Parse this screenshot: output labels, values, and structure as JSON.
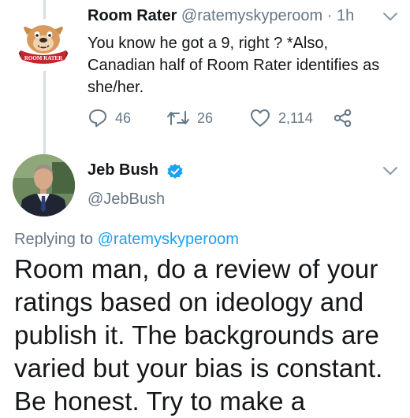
{
  "tweet1": {
    "display_name": "Room Rater",
    "handle": "@ratemyskyperoom",
    "separator": "·",
    "time": "1h",
    "avatar_text": "ROOM RATER",
    "body": "You know he got a 9, right ? *Also, Canadian half of Room Rater identifies as she/her.",
    "reply_count": "46",
    "retweet_count": "26",
    "like_count": "2,114"
  },
  "tweet2": {
    "display_name": "Jeb Bush",
    "handle": "@JebBush",
    "replying_prefix": "Replying to",
    "replying_handle": "@ratemyskyperoom",
    "body": "Room man, do a review of your ratings based on ideology and publish it. The backgrounds are varied but your bias is constant. Be honest. Try to make a"
  },
  "colors": {
    "text": "#14171a",
    "secondary": "#657786",
    "link": "#1da1f2",
    "thread_line": "#d8dde1"
  }
}
